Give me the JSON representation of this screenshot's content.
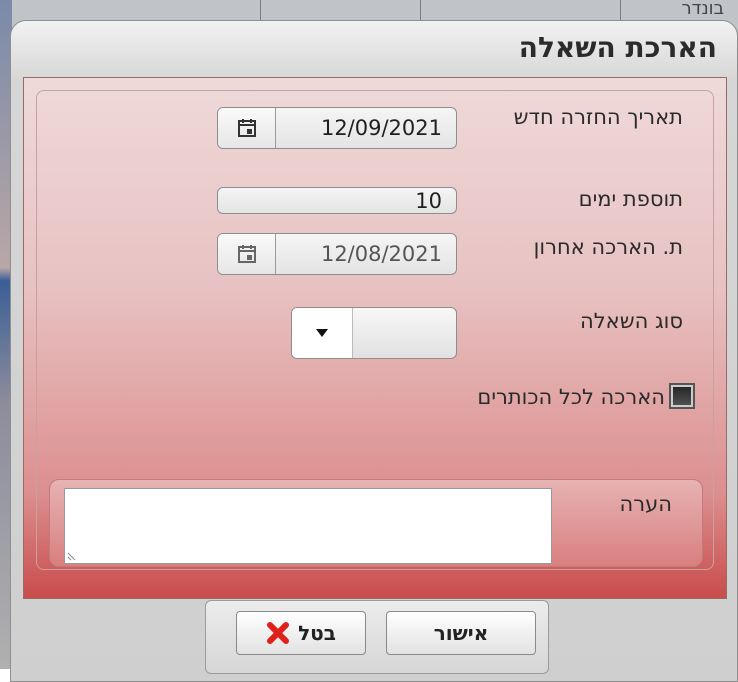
{
  "background": {
    "partial_text": "בונדר"
  },
  "dialog": {
    "title": "הארכת השאלה"
  },
  "form": {
    "new_return_date": {
      "label": "תאריך החזרה חדש",
      "value": "12/09/2021"
    },
    "additional_days": {
      "label": "תוספת ימים",
      "value": "10"
    },
    "last_extension_date": {
      "label": "ת. הארכה אחרון",
      "value": "12/08/2021"
    },
    "loan_type": {
      "label": "סוג השאלה",
      "value": ""
    },
    "extend_all_titles": {
      "label": "הארכה לכל הכותרים",
      "checked": true
    },
    "note": {
      "label": "הערה",
      "value": ""
    }
  },
  "buttons": {
    "confirm": "אישור",
    "cancel": "בטל"
  },
  "colors": {
    "gradient_top": "#efd9d9",
    "gradient_bottom": "#c94c4c",
    "cancel_icon": "#e0201a"
  }
}
